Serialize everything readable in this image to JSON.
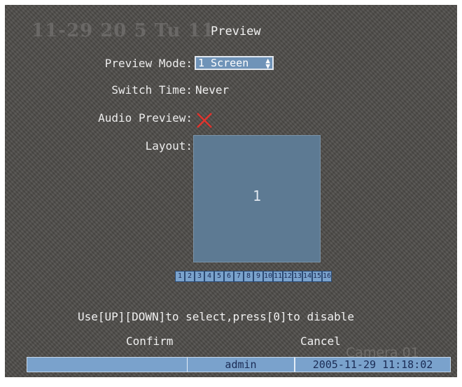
{
  "osd": {
    "overlay_text": "11-29 20 5 Tu 11"
  },
  "screen": {
    "title": "Preview"
  },
  "preview_mode": {
    "label": "Preview Mode:",
    "value": "1 Screen",
    "arrows_icon": "up-down-arrows"
  },
  "switch_time": {
    "label": "Switch Time:",
    "value": "Never"
  },
  "audio_preview": {
    "label": "Audio Preview:",
    "state_icon": "red-x-icon",
    "enabled": false
  },
  "layout": {
    "label": "Layout:",
    "window_number": "1"
  },
  "channels": [
    "1",
    "2",
    "3",
    "4",
    "5",
    "6",
    "7",
    "8",
    "9",
    "10",
    "11",
    "12",
    "13",
    "14",
    "15",
    "16"
  ],
  "hint": "Use[UP][DOWN]to select,press[0]to disable",
  "buttons": {
    "confirm": "Confirm",
    "cancel": "Cancel"
  },
  "watermark": "Camera 01",
  "status": {
    "user": "admin",
    "datetime": "2005-11-29 11:18:02"
  },
  "colors": {
    "selection_blue": "#7aa2cc",
    "layout_blue": "#5d7a93",
    "x_red": "#e0342e"
  }
}
